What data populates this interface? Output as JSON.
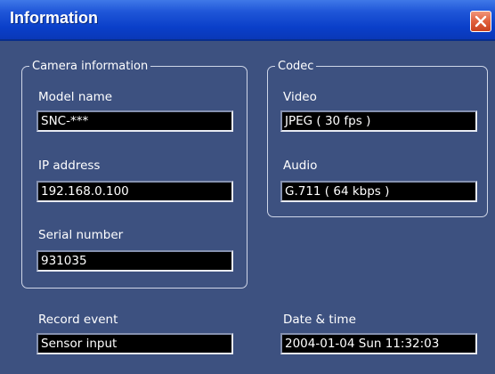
{
  "window": {
    "title": "Information",
    "close": "close"
  },
  "camera": {
    "legend": "Camera information",
    "model_label": "Model name",
    "model_value": "SNC-***",
    "ip_label": "IP address",
    "ip_value": "192.168.0.100",
    "serial_label": "Serial number",
    "serial_value": "931035"
  },
  "codec": {
    "legend": "Codec",
    "video_label": "Video",
    "video_value": "JPEG ( 30 fps )",
    "audio_label": "Audio",
    "audio_value": "G.711 ( 64 kbps )"
  },
  "event": {
    "label": "Record event",
    "value": "Sensor input"
  },
  "datetime": {
    "label": "Date & time",
    "value": "2004-01-04 Sun 11:32:03"
  },
  "colors": {
    "background": "#3d5180",
    "titlebar": "#0a3fc9",
    "close": "#e0603c"
  }
}
